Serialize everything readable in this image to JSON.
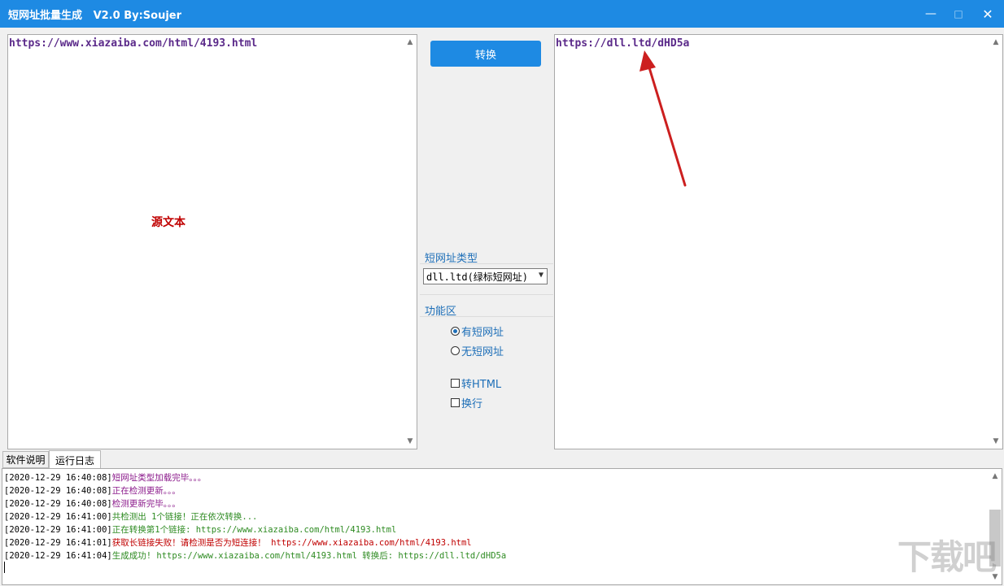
{
  "window": {
    "title": "短网址批量生成   V2.0 By:Soujer",
    "minimize": "—",
    "maximize": "□",
    "close": "✕"
  },
  "source": {
    "text": "https://www.xiazaiba.com/html/4193.html",
    "label": "源文本"
  },
  "output": {
    "text": "https://dll.ltd/dHD5a"
  },
  "controls": {
    "convert_label": "转换",
    "shorturl_type_label": "短网址类型",
    "shorturl_type_value": "dll.ltd(绿标短网址)",
    "function_label": "功能区",
    "radio_has_short": "有短网址",
    "radio_no_short": "无短网址",
    "check_html": "转HTML",
    "check_newline": "换行"
  },
  "tabs": [
    "软件说明",
    "运行日志"
  ],
  "log": [
    {
      "ts": "[2020-12-29 16:40:08]",
      "msg": "短网址类型加载完毕。。。",
      "color": "#8b1a8b"
    },
    {
      "ts": "[2020-12-29 16:40:08]",
      "msg": "正在检测更新。。。",
      "color": "#8b1a8b"
    },
    {
      "ts": "[2020-12-29 16:40:08]",
      "msg": "检测更新完毕。。。",
      "color": "#8b1a8b"
    },
    {
      "ts": "[2020-12-29 16:41:00]",
      "msg": "共检测出 1个链接！正在依次转换...",
      "color": "#2e8b22"
    },
    {
      "ts": "[2020-12-29 16:41:00]",
      "msg": "正在转换第1个链接: https://www.xiazaiba.com/html/4193.html",
      "color": "#2e8b22"
    },
    {
      "ts": "[2020-12-29 16:41:01]",
      "msg": "获取长链接失败！请检测是否为短连接！ https://www.xiazaiba.com/html/4193.html",
      "color": "#c00000"
    },
    {
      "ts": "[2020-12-29 16:41:04]",
      "msg": "生成成功! https://www.xiazaiba.com/html/4193.html 转换后: https://dll.ltd/dHD5a",
      "color": "#2e8b22"
    }
  ],
  "watermark": "下载吧",
  "colors": {
    "accent": "#1e8ae3",
    "arrow": "#cc1f1f"
  }
}
